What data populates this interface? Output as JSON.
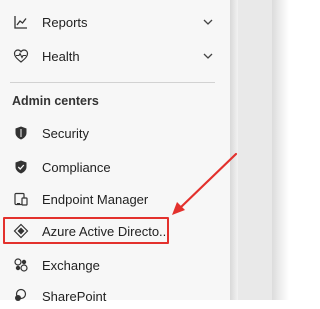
{
  "nav": {
    "items_top": [
      {
        "label": "Reports",
        "icon": "chart-line-icon"
      },
      {
        "label": "Health",
        "icon": "heart-pulse-icon"
      }
    ],
    "section_title": "Admin centers",
    "admin_centers": [
      {
        "label": "Security",
        "icon": "shield-icon"
      },
      {
        "label": "Compliance",
        "icon": "shield-check-icon"
      },
      {
        "label": "Endpoint Manager",
        "icon": "device-manager-icon"
      },
      {
        "label": "Azure Active Directo...",
        "icon": "azure-ad-diamond-icon"
      },
      {
        "label": "Exchange",
        "icon": "exchange-icon"
      },
      {
        "label": "SharePoint",
        "icon": "sharepoint-icon"
      }
    ]
  },
  "annotation": {
    "highlight_color": "#e3312d"
  },
  "colors": {
    "panel_bg": "#f7f7f7",
    "text": "#222222",
    "azure_icon": "#0078d4"
  }
}
